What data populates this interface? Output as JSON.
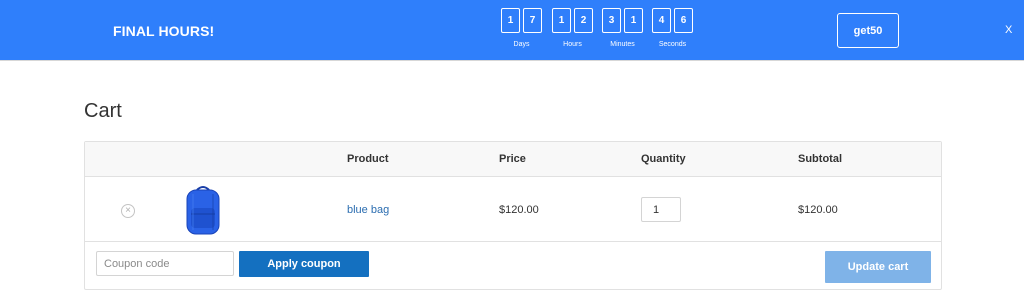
{
  "banner": {
    "title": "FINAL HOURS!",
    "countdown": [
      {
        "digits": [
          "1",
          "7"
        ],
        "label": "Days"
      },
      {
        "digits": [
          "1",
          "2"
        ],
        "label": "Hours"
      },
      {
        "digits": [
          "3",
          "1"
        ],
        "label": "Minutes"
      },
      {
        "digits": [
          "4",
          "6"
        ],
        "label": "Seconds"
      }
    ],
    "promo_code": "get50",
    "close_label": "X",
    "background_color": "#2f7ffb"
  },
  "cart": {
    "title": "Cart",
    "columns": [
      "Product",
      "Price",
      "Quantity",
      "Subtotal"
    ],
    "items": [
      {
        "remove_label": "×",
        "thumbnail": "blue-backpack-image",
        "product": "blue bag",
        "price": "$120.00",
        "quantity": "1",
        "subtotal": "$120.00"
      }
    ],
    "coupon": {
      "placeholder": "Coupon code",
      "value": "",
      "apply_label": "Apply coupon"
    },
    "update_label": "Update cart",
    "accent_color": "#1470c0"
  }
}
